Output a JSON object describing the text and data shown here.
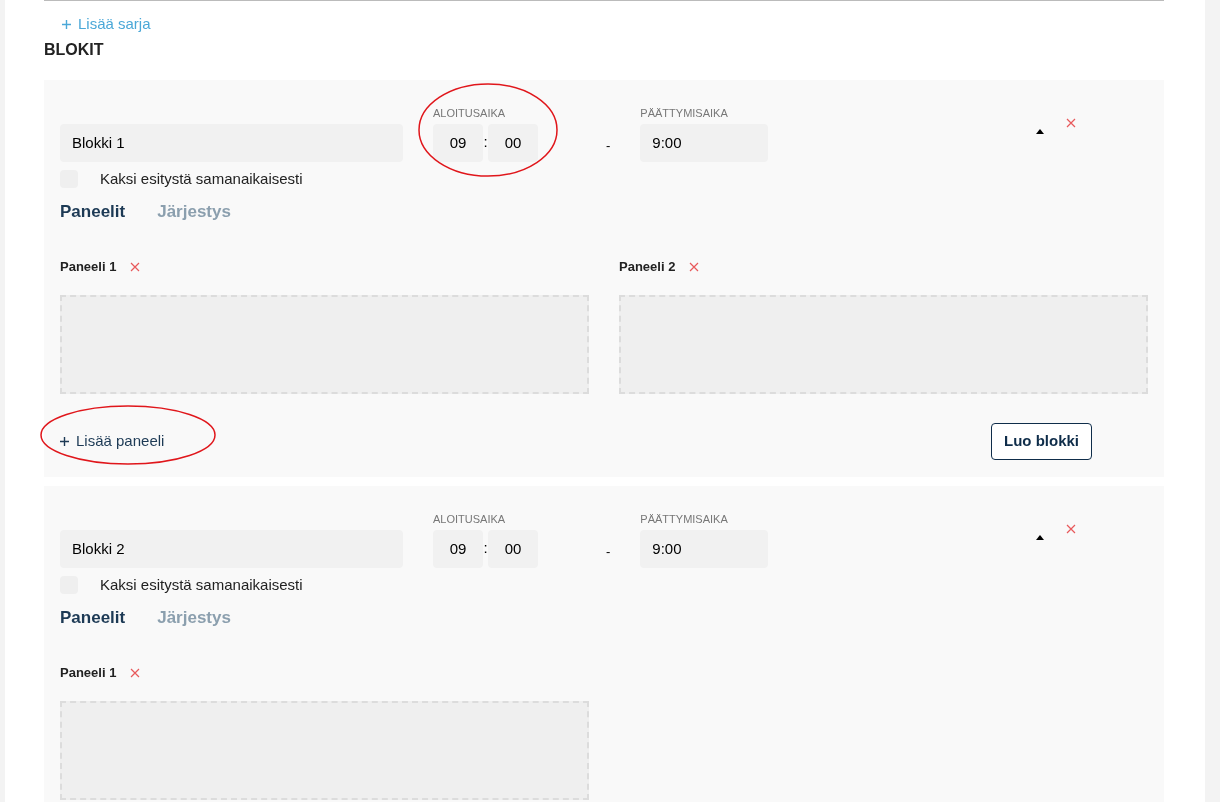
{
  "add_series": {
    "label": "Lisää sarja"
  },
  "section_title": "BLOKIT",
  "blocks": [
    {
      "name": "Blokki 1",
      "start_label": "ALOITUSAIKA",
      "start_hours": "09",
      "start_separator": ":",
      "start_minutes": "00",
      "range_dash": "-",
      "end_label": "PÄÄTTYMISAIKA",
      "end_time": "9:00",
      "simultaneous": {
        "label": "Kaksi esitystä samanaikaisesti",
        "checked": false
      },
      "tabs": [
        {
          "label": "Paneelit",
          "selected": true
        },
        {
          "label": "Järjestys",
          "selected": false
        }
      ],
      "panels": [
        {
          "title": "Paneeli 1"
        },
        {
          "title": "Paneeli 2"
        }
      ],
      "add_panel": "Lisää paneeli",
      "create_button": "Luo blokki"
    },
    {
      "name": "Blokki 2",
      "start_label": "ALOITUSAIKA",
      "start_hours": "09",
      "start_separator": ":",
      "start_minutes": "00",
      "range_dash": "-",
      "end_label": "PÄÄTTYMISAIKA",
      "end_time": "9:00",
      "simultaneous": {
        "label": "Kaksi esitystä samanaikaisesti",
        "checked": false
      },
      "tabs": [
        {
          "label": "Paneelit",
          "selected": true
        },
        {
          "label": "Järjestys",
          "selected": false
        }
      ],
      "panels": [
        {
          "title": "Paneeli 1"
        }
      ]
    }
  ]
}
